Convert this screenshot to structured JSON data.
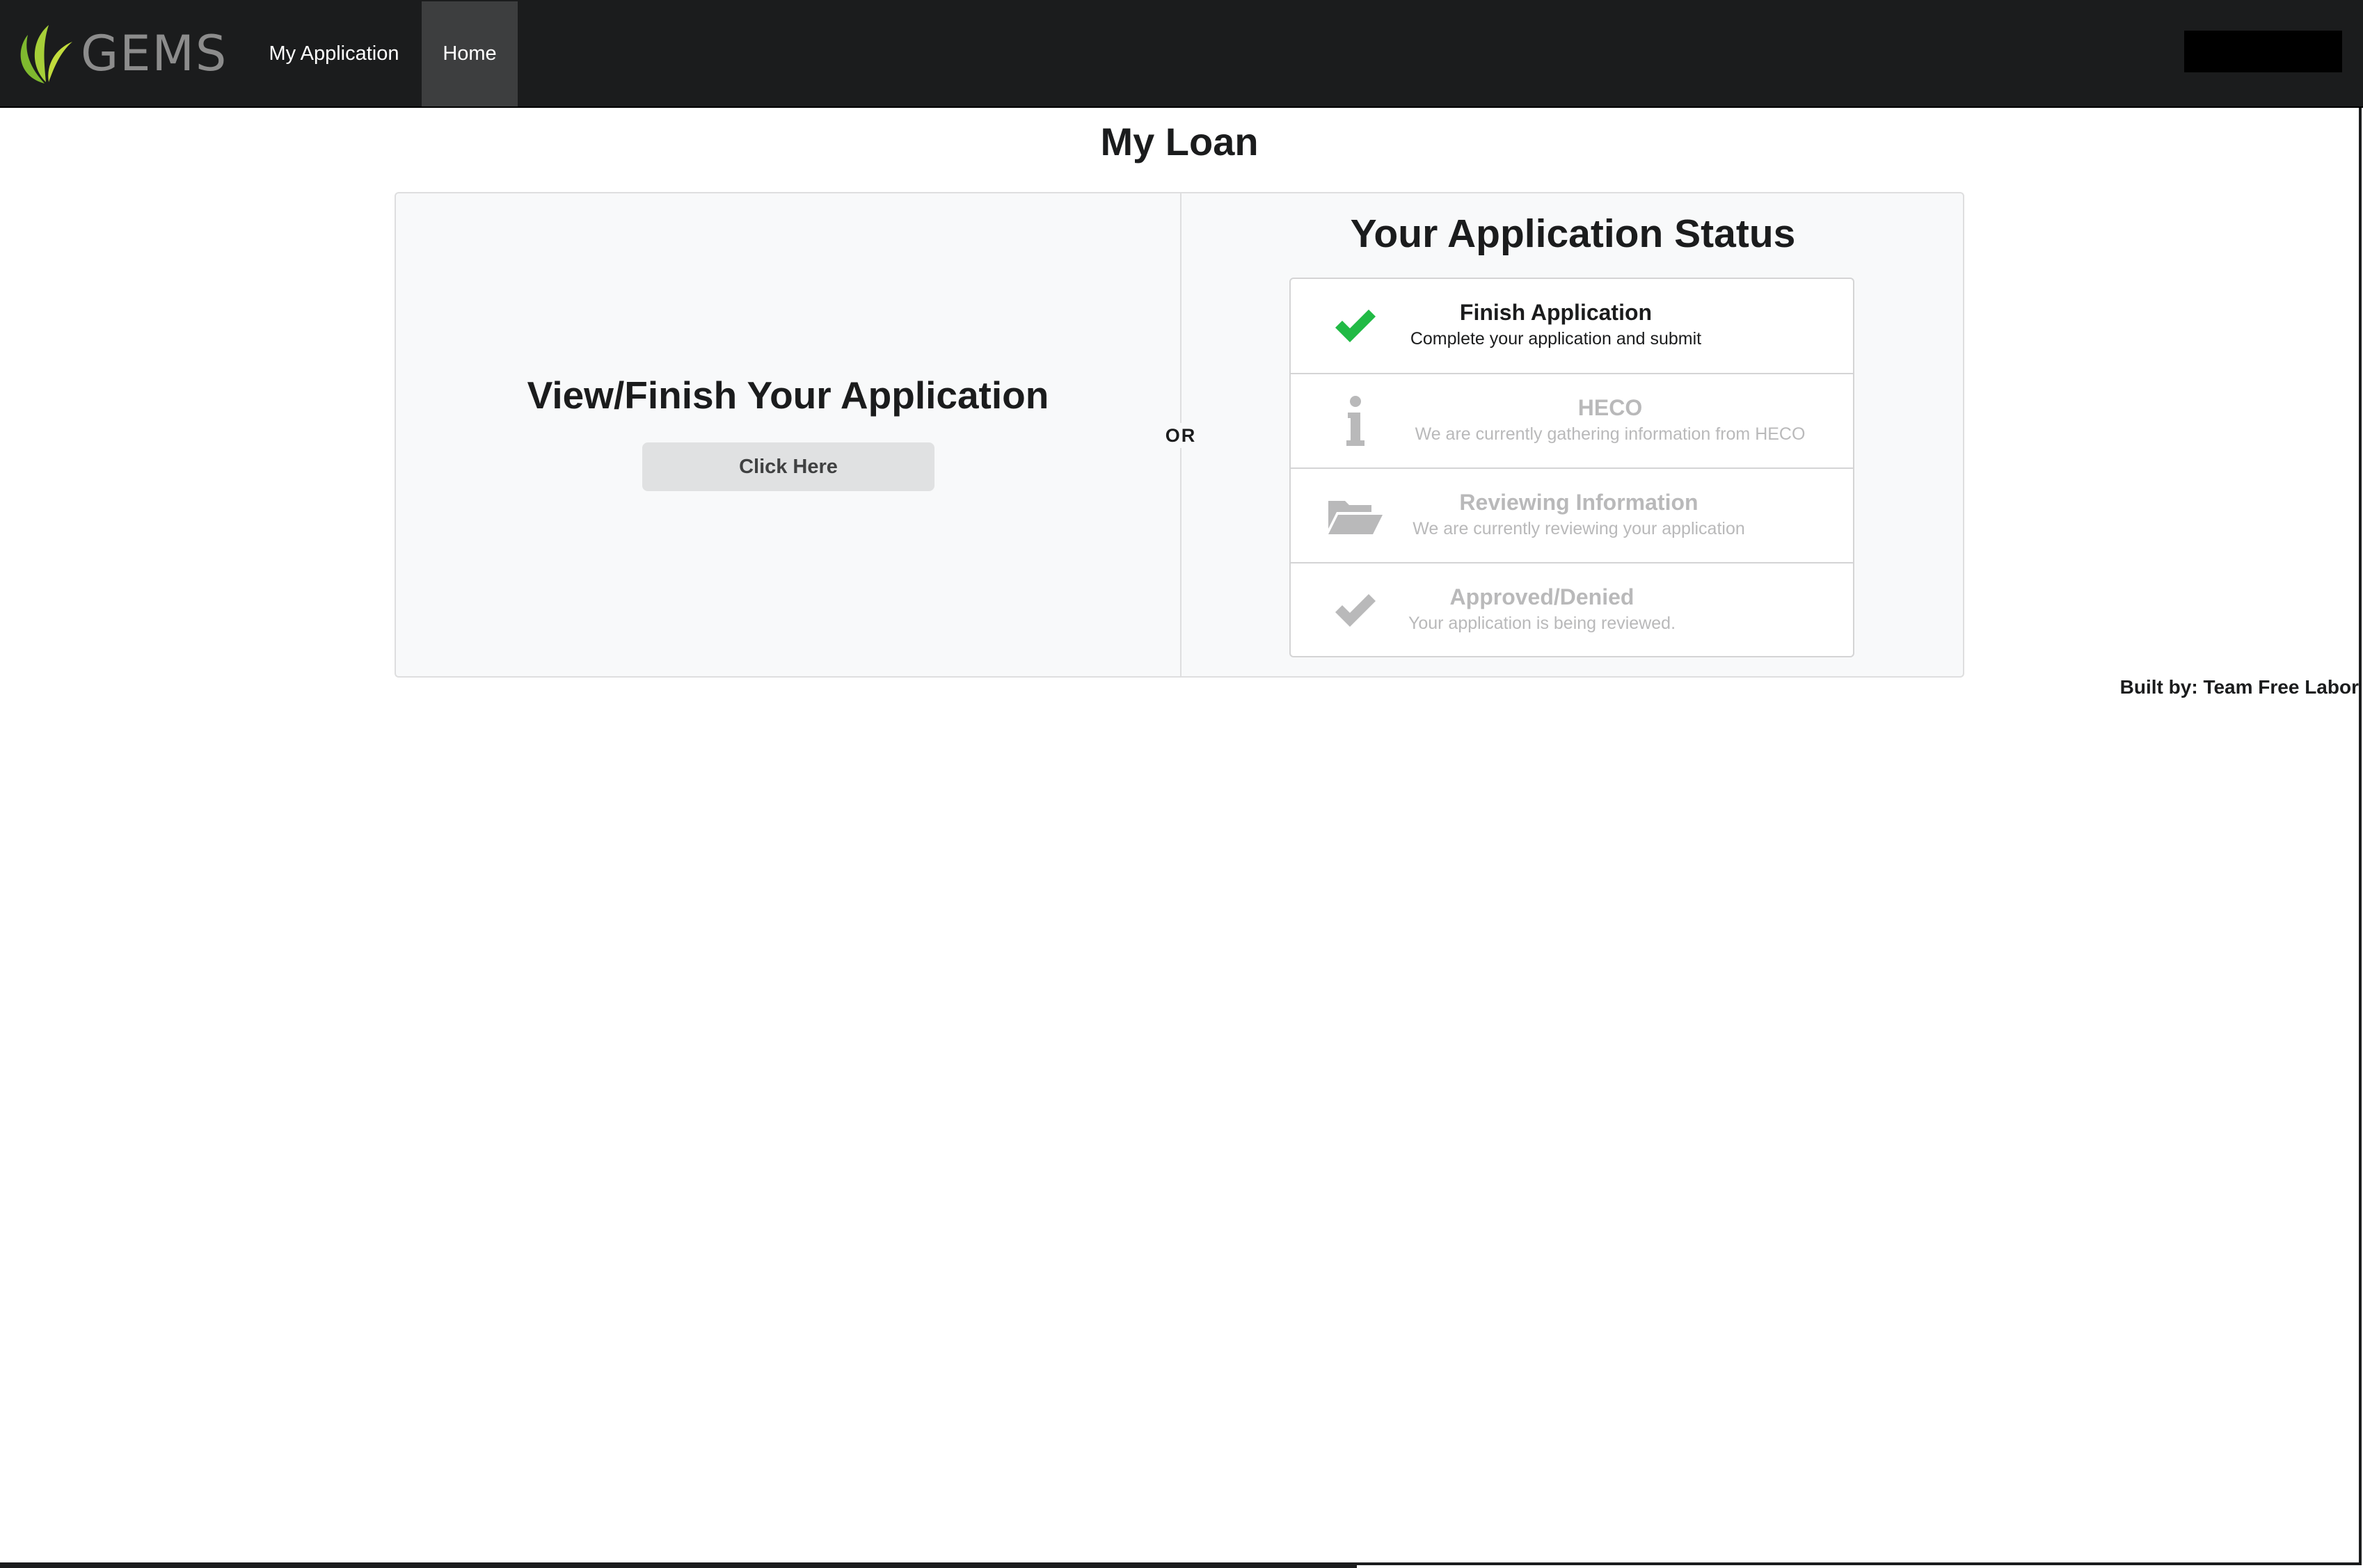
{
  "app": {
    "brand_name": "GEMS",
    "brand_color": "#8dc63f"
  },
  "nav": {
    "items": [
      {
        "label": "My Application"
      },
      {
        "label": "Home"
      }
    ],
    "active": "Home"
  },
  "page": {
    "title": "My Loan",
    "left_panel": {
      "header": "View/Finish Your Application",
      "button_label": "Click Here"
    },
    "divider_label": "OR",
    "right_panel": {
      "header": "Your Application Status",
      "steps": [
        {
          "icon": "checkmark-icon",
          "title": "Finish Application",
          "description": "Complete your application and submit",
          "state": "active",
          "icon_color": "#21ba45"
        },
        {
          "icon": "info-icon",
          "title": "HECO",
          "description": "We are currently gathering information from HECO",
          "state": "disabled"
        },
        {
          "icon": "open-folder-icon",
          "title": "Reviewing Information",
          "description": "We are currently reviewing your application",
          "state": "disabled"
        },
        {
          "icon": "checkmark-icon",
          "title": "Approved/Denied",
          "description": "Your application is being reviewed.",
          "state": "disabled"
        }
      ]
    }
  },
  "footer": {
    "credit": "Built by: Team Free Labor"
  }
}
